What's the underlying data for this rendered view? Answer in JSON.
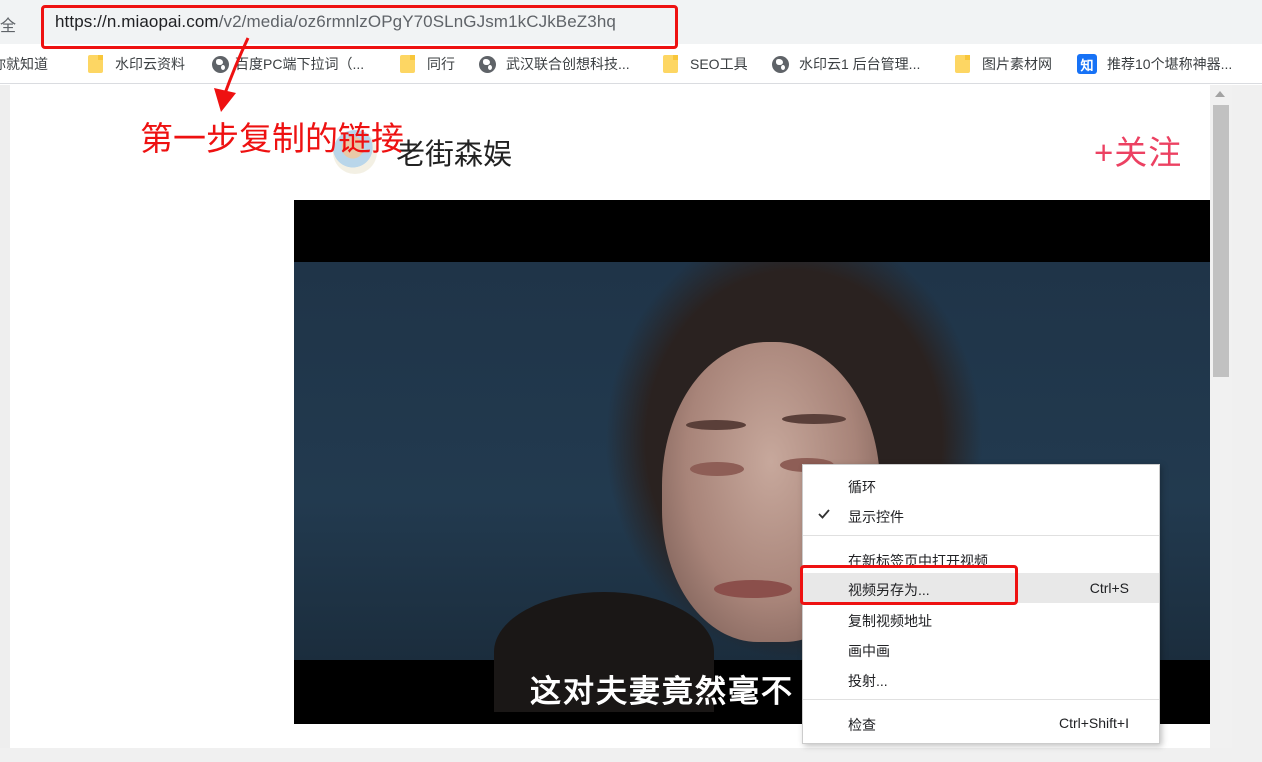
{
  "browser": {
    "secure_label": "安全",
    "url_host": "https://n.miaopai.com",
    "url_path": "/v2/media/oz6rmnlzOPgY70SLnGJsm1kCJkBeZ3hq"
  },
  "bookmarks": [
    {
      "label": "你就知道",
      "icon": "none"
    },
    {
      "label": "水印云资料",
      "icon": "folder-icon"
    },
    {
      "label": "百度PC端下拉词（...",
      "icon": "globe-icon"
    },
    {
      "label": "同行",
      "icon": "folder-icon"
    },
    {
      "label": "武汉联合创想科技...",
      "icon": "globe-icon"
    },
    {
      "label": "SEO工具",
      "icon": "folder-icon"
    },
    {
      "label": "水印云1 后台管理...",
      "icon": "globe-icon"
    },
    {
      "label": "图片素材网",
      "icon": "folder-icon"
    },
    {
      "label": "推荐10个堪称神器...",
      "icon": "zhihu-icon",
      "icon_text": "知"
    }
  ],
  "page": {
    "username": "老街森娱",
    "follow_label": "+关注",
    "video_subtitle": "这对夫妻竟然毫不"
  },
  "context_menu": {
    "items": [
      {
        "label": "循环",
        "shortcut": "",
        "checked": false
      },
      {
        "label": "显示控件",
        "shortcut": "",
        "checked": true
      },
      {
        "label": "在新标签页中打开视频",
        "shortcut": "",
        "checked": false
      },
      {
        "label": "视频另存为...",
        "shortcut": "Ctrl+S",
        "checked": false,
        "highlighted": true
      },
      {
        "label": "复制视频地址",
        "shortcut": "",
        "checked": false
      },
      {
        "label": "画中画",
        "shortcut": "",
        "checked": false
      },
      {
        "label": "投射...",
        "shortcut": "",
        "checked": false
      },
      {
        "label": "检查",
        "shortcut": "Ctrl+Shift+I",
        "checked": false
      }
    ]
  },
  "annotation": {
    "text": "第一步复制的链接",
    "color": "#ee1111"
  },
  "colors": {
    "follow": "#ec4162",
    "annotation": "#ee1111",
    "menu_highlight": "#e8e8e8"
  }
}
